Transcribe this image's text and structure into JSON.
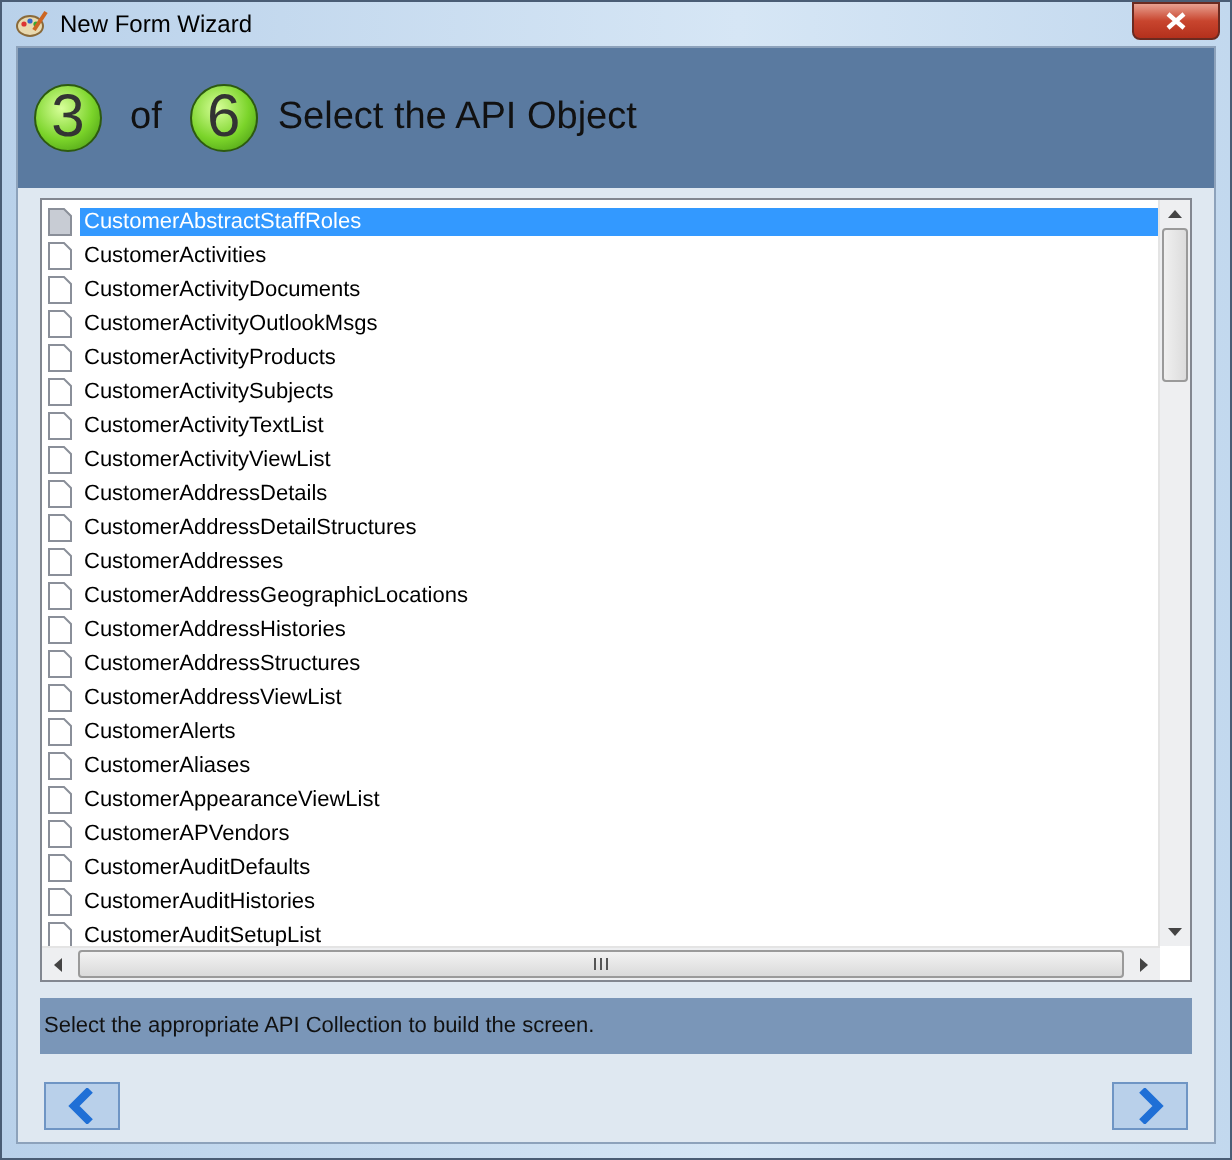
{
  "window": {
    "title": "New Form Wizard"
  },
  "header": {
    "step": "3",
    "of": "of",
    "total": "6",
    "title": "Select the API Object"
  },
  "objects": [
    {
      "name": "CustomerAbstractStaffRoles",
      "selected": true
    },
    {
      "name": "CustomerActivities",
      "selected": false
    },
    {
      "name": "CustomerActivityDocuments",
      "selected": false
    },
    {
      "name": "CustomerActivityOutlookMsgs",
      "selected": false
    },
    {
      "name": "CustomerActivityProducts",
      "selected": false
    },
    {
      "name": "CustomerActivitySubjects",
      "selected": false
    },
    {
      "name": "CustomerActivityTextList",
      "selected": false
    },
    {
      "name": "CustomerActivityViewList",
      "selected": false
    },
    {
      "name": "CustomerAddressDetails",
      "selected": false
    },
    {
      "name": "CustomerAddressDetailStructures",
      "selected": false
    },
    {
      "name": "CustomerAddresses",
      "selected": false
    },
    {
      "name": "CustomerAddressGeographicLocations",
      "selected": false
    },
    {
      "name": "CustomerAddressHistories",
      "selected": false
    },
    {
      "name": "CustomerAddressStructures",
      "selected": false
    },
    {
      "name": "CustomerAddressViewList",
      "selected": false
    },
    {
      "name": "CustomerAlerts",
      "selected": false
    },
    {
      "name": "CustomerAliases",
      "selected": false
    },
    {
      "name": "CustomerAppearanceViewList",
      "selected": false
    },
    {
      "name": "CustomerAPVendors",
      "selected": false
    },
    {
      "name": "CustomerAuditDefaults",
      "selected": false
    },
    {
      "name": "CustomerAuditHistories",
      "selected": false
    },
    {
      "name": "CustomerAuditSetupList",
      "selected": false
    }
  ],
  "hint": "Select the appropriate API Collection to build the screen."
}
